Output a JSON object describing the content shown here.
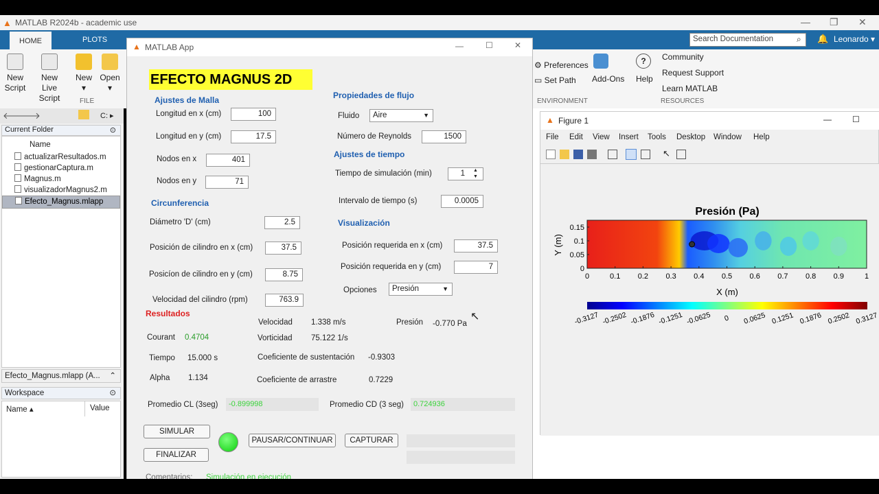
{
  "window": {
    "title": "MATLAB R2024b - academic use"
  },
  "ribbon": {
    "tabs": [
      "HOME",
      "PLOTS"
    ],
    "buttons": [
      "New\nScript",
      "New\nLive Script",
      "New",
      "Open"
    ],
    "group": "FILE"
  },
  "current_folder": {
    "title": "Current Folder",
    "column": "Name",
    "files": [
      "actualizarResultados.m",
      "gestionarCaptura.m",
      "Magnus.m",
      "visualizadorMagnus2.m",
      "Efecto_Magnus.mlapp"
    ],
    "footer": "Efecto_Magnus.mlapp (A..."
  },
  "workspace": {
    "title": "Workspace",
    "col_name": "Name ▴",
    "col_value": "Value"
  },
  "app": {
    "window_title": "MATLAB App",
    "banner": "EFECTO MAGNUS 2D",
    "malla": {
      "title": "Ajustes de Malla",
      "lx_label": "Longitud en x (cm)",
      "lx": "100",
      "ly_label": "Longitud en y (cm)",
      "ly": "17.5",
      "nx_label": "Nodos en x",
      "nx": "401",
      "ny_label": "Nodos en y",
      "ny": "71"
    },
    "circ": {
      "title": "Circunferencia",
      "d_label": "Diámetro 'D' (cm)",
      "d": "2.5",
      "px_label": "Posición de cilindro en x (cm)",
      "px": "37.5",
      "py_label": "Posicíon  de cilindro en y (cm)",
      "py": "8.75",
      "v_label": "Velocidad del cilindro (rpm)",
      "v": "763.9"
    },
    "flujo": {
      "title": "Propiedades de flujo",
      "fluido_label": "Fluido",
      "fluido": "Aire",
      "re_label": "Número de Reynolds",
      "re": "1500"
    },
    "tiempo": {
      "title": "Ajustes de tiempo",
      "ts_label": "Tiempo de simulación (min)",
      "ts": "1",
      "dt_label": "Intervalo de tiempo (s)",
      "dt": "0.0005"
    },
    "vis": {
      "title": "Visualización",
      "px_label": "Posición requerida en x (cm)",
      "px": "37.5",
      "py_label": "Posición requerida en y (cm)",
      "py": "7",
      "op_label": "Opciones",
      "op": "Presión"
    },
    "res": {
      "title": "Resultados",
      "courant_label": "Courant",
      "courant": "0.4704",
      "tiempo_label": "Tiempo",
      "tiempo": "15.000 s",
      "alpha_label": "Alpha",
      "alpha": "1.134",
      "vel_label": "Velocidad",
      "vel": "1.338 m/s",
      "vort_label": "Vorticidad",
      "vort": "75.122 1/s",
      "cl_label": "Coeficiente de sustentación",
      "cl": "-0.9303",
      "cd_label": "Coeficiente de arrastre",
      "cd": "0.7229",
      "pres_label": "Presión",
      "pres": "-0.770 Pa",
      "pcl_label": "Promedio CL (3seg)",
      "pcl": "-0.899998",
      "pcd_label": "Promedio CD (3 seg)",
      "pcd": "0.724936"
    },
    "buttons": {
      "simular": "SIMULAR",
      "finalizar": "FINALIZAR",
      "pausar": "PAUSAR/CONTINUAR",
      "capturar": "CAPTURAR"
    },
    "comments": {
      "label": "Comentarios:",
      "value": "Simulación en ejecución"
    }
  },
  "matlab_right": {
    "search_placeholder": "Search Documentation",
    "user": "Leonardo ▾",
    "prefs": "Preferences",
    "setpath": "Set Path",
    "addons": "Add-Ons",
    "help": "Help",
    "community": "Community",
    "support": "Request Support",
    "learn": "Learn MATLAB",
    "env": "ENVIRONMENT",
    "resources": "RESOURCES"
  },
  "figure": {
    "title": "Figure 1",
    "menu": [
      "File",
      "Edit",
      "View",
      "Insert",
      "Tools",
      "Desktop",
      "Window",
      "Help"
    ],
    "chart_data": {
      "type": "heatmap",
      "title": "Presión (Pa)",
      "xlabel": "X (m)",
      "ylabel": "Y (m)",
      "xticks": [
        "0",
        "0.1",
        "0.2",
        "0.3",
        "0.4",
        "0.5",
        "0.6",
        "0.7",
        "0.8",
        "0.9",
        "1"
      ],
      "yticks": [
        "0",
        "0.05",
        "0.1",
        "0.15"
      ],
      "xlim": [
        0,
        1
      ],
      "ylim": [
        0,
        0.175
      ],
      "colorbar_ticks": [
        "-0.3127",
        "-0.2502",
        "-0.1876",
        "-0.1251",
        "-0.0625",
        "0",
        "0.0625",
        "0.1251",
        "0.1876",
        "0.2502",
        "0.3127"
      ],
      "clim": [
        -0.3127,
        0.3127
      ],
      "colormap": "jet"
    }
  }
}
